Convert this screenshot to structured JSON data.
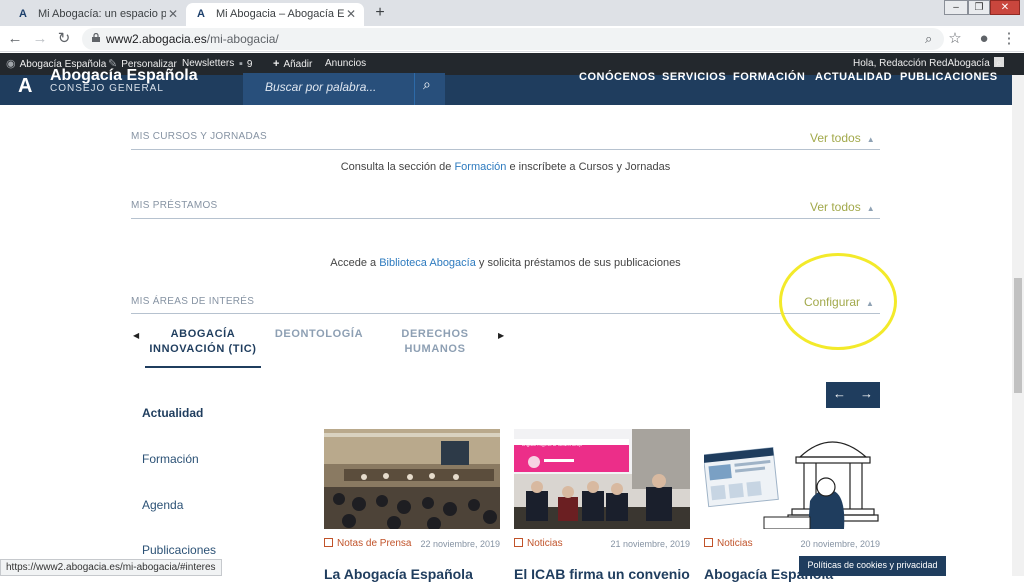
{
  "browser": {
    "tabs": [
      {
        "title": "Mi Abogacía: un espacio persona",
        "active": false
      },
      {
        "title": "Mi Abogacia – Abogacía Españo",
        "active": true
      }
    ],
    "url_host": "www2.abogacia.es",
    "url_path": "/mi-abogacia/",
    "status_url": "https://www2.abogacia.es/mi-abogacia/#interes"
  },
  "admin_bar": {
    "site": "Abogacía Española",
    "customize": "Personalizar",
    "newsletters": "Newsletters",
    "comments_count": "9",
    "add_new": "Añadir",
    "ads": "Anuncios",
    "greeting": "Hola, Redacción RedAbogacía"
  },
  "header": {
    "logo_name": "Abogacía Española",
    "logo_sub": "CONSEJO GENERAL",
    "search_placeholder": "Buscar por palabra...",
    "nav": [
      "CONÓCENOS",
      "SERVICIOS",
      "FORMACIÓN",
      "ACTUALIDAD",
      "PUBLICACIONES"
    ]
  },
  "sections": {
    "cursos": {
      "title": "MIS CURSOS Y JORNADAS",
      "link": "Ver todos",
      "text_before": "Consulta la sección de ",
      "text_link": "Formación",
      "text_after": " e inscríbete a Cursos y Jornadas"
    },
    "prestamos": {
      "title": "MIS PRÉSTAMOS",
      "link": "Ver todos",
      "text_before": "Accede a ",
      "text_link": "Biblioteca Abogacía",
      "text_after": " y solicita préstamos de sus publicaciones"
    },
    "areas": {
      "title": "MIS ÁREAS DE INTERÉS",
      "link": "Configurar"
    }
  },
  "interest_tabs": [
    {
      "line1": "ABOGACÍA",
      "line2": "INNOVACIÓN (TIC)",
      "active": true
    },
    {
      "line1": "DEONTOLOGÍA",
      "line2": "",
      "active": false
    },
    {
      "line1": "DERECHOS",
      "line2": "HUMANOS",
      "active": false
    }
  ],
  "sidebar": [
    "Actualidad",
    "Formación",
    "Agenda",
    "Publicaciones"
  ],
  "cards": [
    {
      "category": "Notas de Prensa",
      "date": "22 noviembre, 2019",
      "title": "La Abogacía Española"
    },
    {
      "category": "Noticias",
      "date": "21 noviembre, 2019",
      "title": "El ICAB firma un convenio"
    },
    {
      "category": "Noticias",
      "date": "20 noviembre, 2019",
      "title": "Abogacía Española"
    }
  ],
  "slide_screen_text": "Digital Rights & Citizenship",
  "cookie_label": "Políticas de cookies y privacidad"
}
